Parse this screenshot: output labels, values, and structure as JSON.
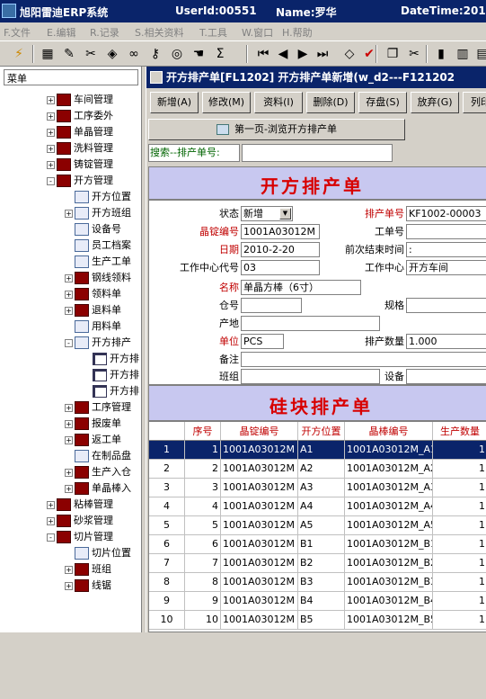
{
  "titlebar": {
    "app_title": "旭阳雷迪ERP系统",
    "userid": "UserId:00551",
    "name": "Name:罗华",
    "datetime": "DateTime:201"
  },
  "menu": [
    "F.文件",
    "E.编辑",
    "R.记录",
    "S.相关资料",
    "T.工具",
    "W.窗口",
    "H.帮助"
  ],
  "toolbar_icons": [
    "lightning-icon",
    "save-icon",
    "edit-icon",
    "scissors-icon",
    "eraser-icon",
    "link-icon",
    "key-icon",
    "binoculars-icon",
    "hand-icon",
    "sigma-icon",
    "first-icon",
    "prev-icon",
    "next-icon",
    "last-icon",
    "eraser2-icon",
    "check-icon",
    "copy-icon",
    "cut-icon",
    "bar-chart-icon",
    "chart2-icon",
    "chart3-icon"
  ],
  "left_panel": {
    "header": "菜单",
    "tree": [
      {
        "label": "车间管理",
        "level": 0,
        "expander": "+",
        "icon": "house"
      },
      {
        "label": "工序委外",
        "level": 0,
        "expander": "+",
        "icon": "house"
      },
      {
        "label": "单晶管理",
        "level": 0,
        "expander": "+",
        "icon": "house"
      },
      {
        "label": "洗料管理",
        "level": 0,
        "expander": "+",
        "icon": "house"
      },
      {
        "label": "铸锭管理",
        "level": 0,
        "expander": "+",
        "icon": "house"
      },
      {
        "label": "开方管理",
        "level": 0,
        "expander": "-",
        "icon": "house"
      },
      {
        "label": "开方位置",
        "level": 1,
        "expander": "",
        "icon": "doc"
      },
      {
        "label": "开方班组",
        "level": 1,
        "expander": "+",
        "icon": "doc"
      },
      {
        "label": "设备号",
        "level": 1,
        "expander": "",
        "icon": "doc"
      },
      {
        "label": "员工档案",
        "level": 1,
        "expander": "",
        "icon": "doc"
      },
      {
        "label": "生产工单",
        "level": 1,
        "expander": "",
        "icon": "doc"
      },
      {
        "label": "钢线领料",
        "level": 1,
        "expander": "+",
        "icon": "house"
      },
      {
        "label": "领料单",
        "level": 1,
        "expander": "+",
        "icon": "house"
      },
      {
        "label": "退料单",
        "level": 1,
        "expander": "+",
        "icon": "house"
      },
      {
        "label": "用料单",
        "level": 1,
        "expander": "",
        "icon": "doc"
      },
      {
        "label": "开方排产",
        "level": 1,
        "expander": "-",
        "icon": "doc"
      },
      {
        "label": "开方排",
        "level": 2,
        "expander": "",
        "icon": "doc2"
      },
      {
        "label": "开方排",
        "level": 2,
        "expander": "",
        "icon": "doc2"
      },
      {
        "label": "开方排",
        "level": 2,
        "expander": "",
        "icon": "doc2"
      },
      {
        "label": "工序管理",
        "level": 1,
        "expander": "+",
        "icon": "house"
      },
      {
        "label": "报废单",
        "level": 1,
        "expander": "+",
        "icon": "house"
      },
      {
        "label": "返工单",
        "level": 1,
        "expander": "+",
        "icon": "house"
      },
      {
        "label": "在制品盘",
        "level": 1,
        "expander": "",
        "icon": "doc"
      },
      {
        "label": "生产入仓",
        "level": 1,
        "expander": "+",
        "icon": "house"
      },
      {
        "label": "单晶棒入",
        "level": 1,
        "expander": "+",
        "icon": "house"
      },
      {
        "label": "粘棒管理",
        "level": 0,
        "expander": "+",
        "icon": "house"
      },
      {
        "label": "砂浆管理",
        "level": 0,
        "expander": "+",
        "icon": "house"
      },
      {
        "label": "切片管理",
        "level": 0,
        "expander": "-",
        "icon": "house"
      },
      {
        "label": "切片位置",
        "level": 1,
        "expander": "",
        "icon": "doc"
      },
      {
        "label": "班组",
        "level": 1,
        "expander": "+",
        "icon": "house"
      },
      {
        "label": "线锯",
        "level": 1,
        "expander": "+",
        "icon": "house"
      }
    ]
  },
  "child": {
    "title": "开方排产单[FL1202] 开方排产单新增(w_d2---F121202",
    "buttons": [
      "新增(A)",
      "修改(M)",
      "资料(I)",
      "删除(D)",
      "存盘(S)",
      "放弃(G)",
      "列印"
    ],
    "page_tab": "第一页-浏览开方排产单",
    "search_label": "搜索--排产单号:",
    "main_header": "开方排产单",
    "form": {
      "status_label": "状态",
      "status_value": "新增",
      "order_no_label": "排产单号",
      "order_no_value": "KF1002-00003",
      "ingot_label": "晶锭编号",
      "ingot_value": "1001A03012M",
      "work_order_label": "工单号",
      "work_order_value": "",
      "date_label": "日期",
      "date_value": "2010-2-20",
      "prev_end_label": "前次结束时间",
      "prev_end_value": ":",
      "wc_code_label": "工作中心代号",
      "wc_code_value": "03",
      "wc_label": "工作中心",
      "wc_value": "开方车间",
      "name_label": "名称",
      "name_value": "单晶方棒（6寸）",
      "warehouse_label": "仓号",
      "warehouse_value": "",
      "spec_label": "规格",
      "spec_value": "",
      "origin_label": "产地",
      "origin_value": "",
      "unit_label": "单位",
      "unit_value": "PCS",
      "qty_label": "排产数量",
      "qty_value": "1.000",
      "remark_label": "备注",
      "remark_value": "",
      "team_label": "班组",
      "team_value": "",
      "device_label": "设备",
      "device_value": ""
    },
    "sub_header": "硅块排产单",
    "grid": {
      "headers": [
        "",
        "序号",
        "晶锭编号",
        "开方位置",
        "晶棒编号",
        "生产数量"
      ],
      "rows": [
        [
          "1",
          "1",
          "1001A03012M",
          "A1",
          "1001A03012M_A1",
          "1"
        ],
        [
          "2",
          "2",
          "1001A03012M",
          "A2",
          "1001A03012M_A2",
          "1"
        ],
        [
          "3",
          "3",
          "1001A03012M",
          "A3",
          "1001A03012M_A3",
          "1"
        ],
        [
          "4",
          "4",
          "1001A03012M",
          "A4",
          "1001A03012M_A4",
          "1"
        ],
        [
          "5",
          "5",
          "1001A03012M",
          "A5",
          "1001A03012M_A5",
          "1"
        ],
        [
          "6",
          "6",
          "1001A03012M",
          "B1",
          "1001A03012M_B1",
          "1"
        ],
        [
          "7",
          "7",
          "1001A03012M",
          "B2",
          "1001A03012M_B2",
          "1"
        ],
        [
          "8",
          "8",
          "1001A03012M",
          "B3",
          "1001A03012M_B3",
          "1"
        ],
        [
          "9",
          "9",
          "1001A03012M",
          "B4",
          "1001A03012M_B4",
          "1"
        ],
        [
          "10",
          "10",
          "1001A03012M",
          "B5",
          "1001A03012M_B5",
          "1"
        ]
      ],
      "selected_row": 0
    }
  },
  "colors": {
    "title_bg": "#0a246a",
    "header_band": "#c8c8f0",
    "red_label": "#c00000",
    "chrome": "#d4d0c8"
  }
}
